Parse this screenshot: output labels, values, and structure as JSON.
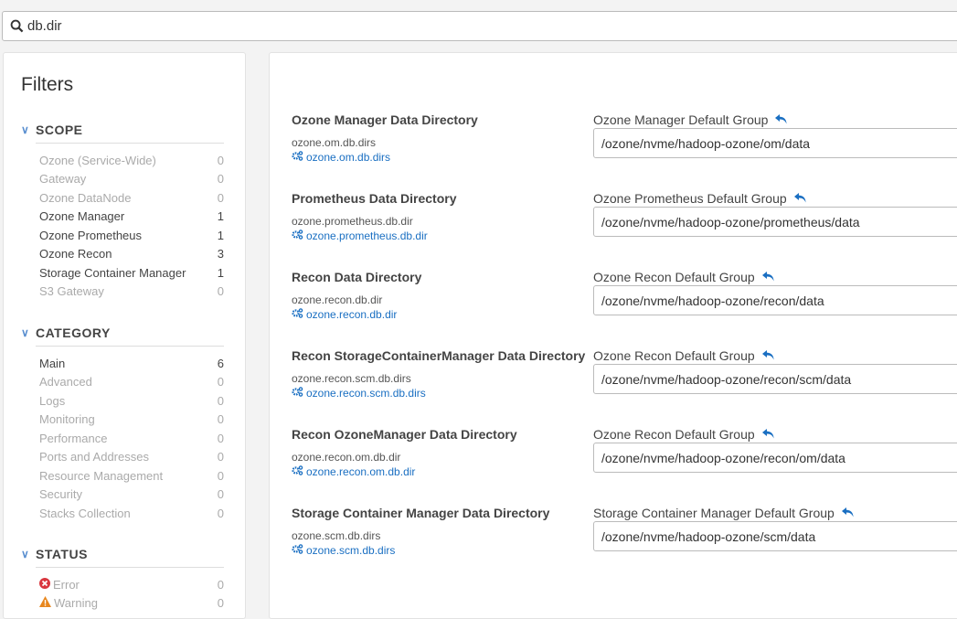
{
  "search": {
    "value": "db.dir"
  },
  "filters": {
    "title": "Filters",
    "scope": {
      "label": "SCOPE",
      "items": [
        {
          "label": "Ozone (Service-Wide)",
          "count": "0"
        },
        {
          "label": "Gateway",
          "count": "0"
        },
        {
          "label": "Ozone DataNode",
          "count": "0"
        },
        {
          "label": "Ozone Manager",
          "count": "1"
        },
        {
          "label": "Ozone Prometheus",
          "count": "1"
        },
        {
          "label": "Ozone Recon",
          "count": "3"
        },
        {
          "label": "Storage Container Manager",
          "count": "1"
        },
        {
          "label": "S3 Gateway",
          "count": "0"
        }
      ]
    },
    "category": {
      "label": "CATEGORY",
      "items": [
        {
          "label": "Main",
          "count": "6"
        },
        {
          "label": "Advanced",
          "count": "0"
        },
        {
          "label": "Logs",
          "count": "0"
        },
        {
          "label": "Monitoring",
          "count": "0"
        },
        {
          "label": "Performance",
          "count": "0"
        },
        {
          "label": "Ports and Addresses",
          "count": "0"
        },
        {
          "label": "Resource Management",
          "count": "0"
        },
        {
          "label": "Security",
          "count": "0"
        },
        {
          "label": "Stacks Collection",
          "count": "0"
        }
      ]
    },
    "status": {
      "label": "STATUS",
      "items": [
        {
          "label": "Error",
          "count": "0",
          "icon": "error-icon"
        },
        {
          "label": "Warning",
          "count": "0",
          "icon": "warning-icon"
        }
      ]
    }
  },
  "properties": [
    {
      "title": "Ozone Manager Data Directory",
      "name": "ozone.om.db.dirs",
      "link": "ozone.om.db.dirs",
      "group": "Ozone Manager Default Group",
      "value": "/ozone/nvme/hadoop-ozone/om/data"
    },
    {
      "title": "Prometheus Data Directory",
      "name": "ozone.prometheus.db.dir",
      "link": "ozone.prometheus.db.dir",
      "group": "Ozone Prometheus Default Group",
      "value": "/ozone/nvme/hadoop-ozone/prometheus/data"
    },
    {
      "title": "Recon Data Directory",
      "name": "ozone.recon.db.dir",
      "link": "ozone.recon.db.dir",
      "group": "Ozone Recon Default Group",
      "value": "/ozone/nvme/hadoop-ozone/recon/data"
    },
    {
      "title": "Recon StorageContainerManager Data Directory",
      "name": "ozone.recon.scm.db.dirs",
      "link": "ozone.recon.scm.db.dirs",
      "group": "Ozone Recon Default Group",
      "value": "/ozone/nvme/hadoop-ozone/recon/scm/data"
    },
    {
      "title": "Recon OzoneManager Data Directory",
      "name": "ozone.recon.om.db.dir",
      "link": "ozone.recon.om.db.dir",
      "group": "Ozone Recon Default Group",
      "value": "/ozone/nvme/hadoop-ozone/recon/om/data"
    },
    {
      "title": "Storage Container Manager Data Directory",
      "name": "ozone.scm.db.dirs",
      "link": "ozone.scm.db.dirs",
      "group": "Storage Container Manager Default Group",
      "value": "/ozone/nvme/hadoop-ozone/scm/data"
    }
  ],
  "colors": {
    "link": "#1a6fc2",
    "error": "#d9363e",
    "warning": "#e8871e"
  }
}
